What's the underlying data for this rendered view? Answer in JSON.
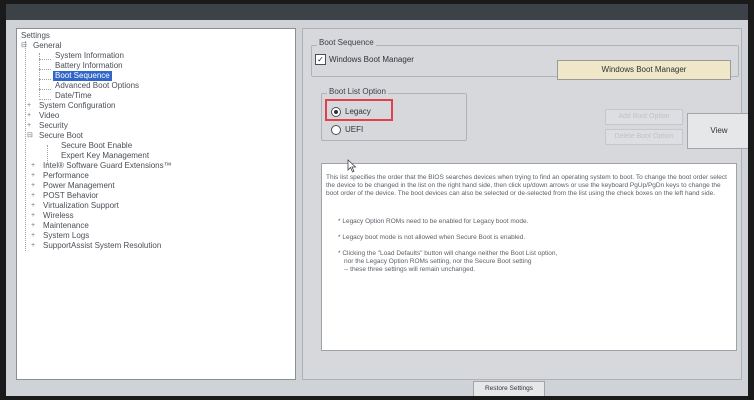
{
  "tree": {
    "settings": "Settings",
    "general": "General",
    "system_information": "System Information",
    "battery_information": "Battery Information",
    "boot_sequence": "Boot Sequence",
    "advanced_boot_options": "Advanced Boot Options",
    "date_time": "Date/Time",
    "system_configuration": "System Configuration",
    "video": "Video",
    "security": "Security",
    "secure_boot": "Secure Boot",
    "secure_boot_enable": "Secure Boot Enable",
    "expert_key_management": "Expert Key Management",
    "intel_sgx": "Intel® Software Guard Extensions™",
    "performance": "Performance",
    "power_management": "Power Management",
    "post_behavior": "POST Behavior",
    "virtualization_support": "Virtualization Support",
    "wireless": "Wireless",
    "maintenance": "Maintenance",
    "system_logs": "System Logs",
    "supportassist": "SupportAssist System Resolution"
  },
  "boot_sequence": {
    "title": "Boot Sequence",
    "item_label": "Windows Boot Manager",
    "list_value": "Windows Boot Manager"
  },
  "boot_list_option": {
    "title": "Boot List Option",
    "legacy": "Legacy",
    "uefi": "UEFI",
    "selected": "Legacy"
  },
  "buttons": {
    "add_boot_option": "Add Boot Option",
    "delete_boot_option": "Delete Boot Option",
    "view": "View",
    "restore_settings": "Restore Settings"
  },
  "info": {
    "para1": "This list specifies the order that the BIOS searches devices when trying to find an operating system to boot. To change the boot order select the device to be changed in the list on the right hand side, then click up/down arrows or use the keyboard PgUp/PgDn keys to change the boot order of the device. The boot devices can also be selected or de-selected from the list using the check boxes on the left hand side.",
    "bullet1": "* Legacy Option ROMs need to be enabled for Legacy boot mode.",
    "bullet2": "* Legacy boot mode is not allowed when Secure Boot is enabled.",
    "bullet3a": "* Clicking the \"Load Defaults\" button will change neither the Boot List option,",
    "bullet3b": "nor the Legacy Option ROMs setting, nor the Secure Boot setting",
    "bullet3c": "-- these three settings will remain unchanged."
  },
  "colors": {
    "highlight": "#e2414b",
    "selected_bg": "#2f66c8",
    "list_box": "#efe7c7"
  }
}
